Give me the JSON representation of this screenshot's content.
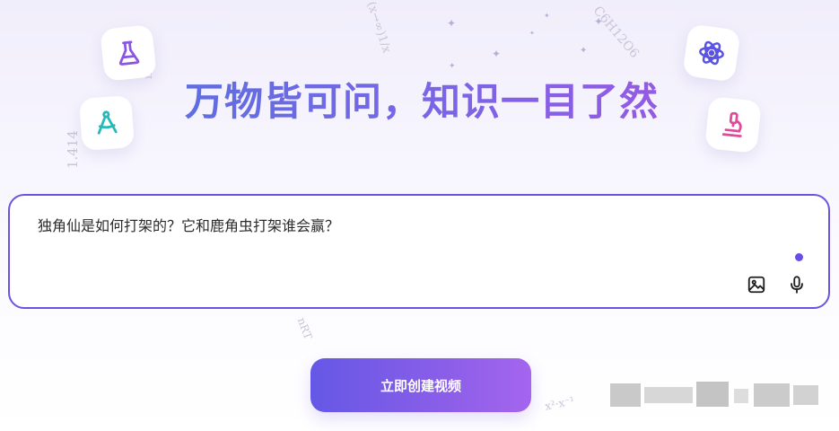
{
  "hero": {
    "headline": "万物皆可问，知识一目了然"
  },
  "prompt": {
    "text": "独角仙是如何打架的？它和鹿角虫打架谁会赢？"
  },
  "actions": {
    "create_video_label": "立即创建视频"
  },
  "icons": {
    "top_left": "flask-icon",
    "left": "compass-icon",
    "top_right": "atom-icon",
    "right": "microscope-icon",
    "image_button": "image-icon",
    "mic_button": "microphone-icon"
  },
  "colors": {
    "accent": "#6a55e0",
    "button_start": "#6558e6",
    "button_end": "#a565ee",
    "status_dot": "#6a4ce6"
  }
}
